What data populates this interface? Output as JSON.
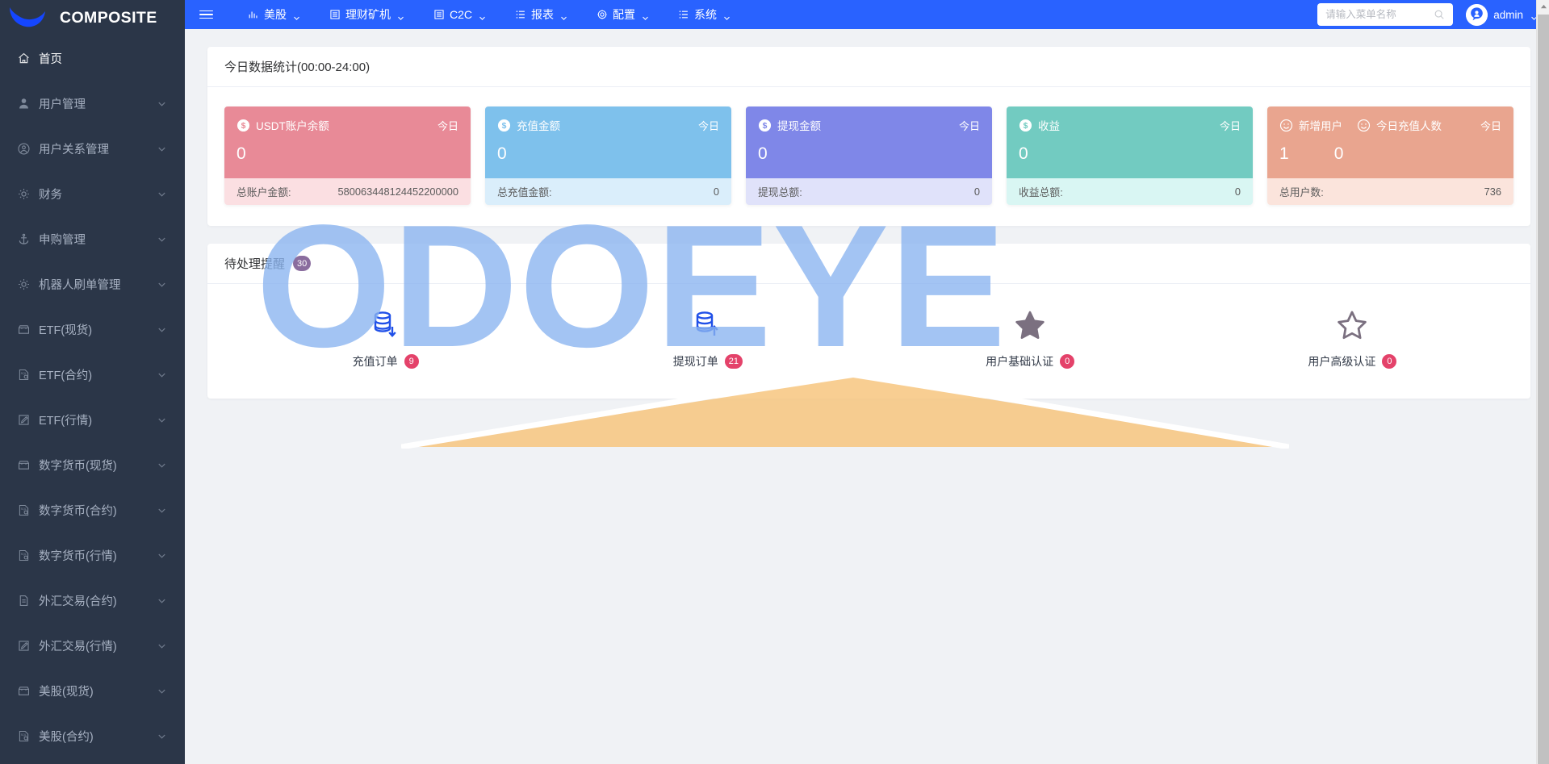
{
  "brand": {
    "title": "COMPOSITE",
    "logo_icon": "crescent-logo-icon"
  },
  "sidebar": {
    "items": [
      {
        "label": "首页",
        "icon": "home-icon",
        "active": true,
        "expandable": false
      },
      {
        "label": "用户管理",
        "icon": "user-icon",
        "active": false,
        "expandable": true
      },
      {
        "label": "用户关系管理",
        "icon": "user-circle-icon",
        "active": false,
        "expandable": true
      },
      {
        "label": "财务",
        "icon": "gear-icon",
        "active": false,
        "expandable": true
      },
      {
        "label": "申购管理",
        "icon": "anchor-icon",
        "active": false,
        "expandable": true
      },
      {
        "label": "机器人刷单管理",
        "icon": "gear-icon",
        "active": false,
        "expandable": true
      },
      {
        "label": "ETF(现货)",
        "icon": "shop-icon",
        "active": false,
        "expandable": true
      },
      {
        "label": "ETF(合约)",
        "icon": "sql-icon",
        "active": false,
        "expandable": true
      },
      {
        "label": "ETF(行情)",
        "icon": "edit-icon",
        "active": false,
        "expandable": true
      },
      {
        "label": "数字货币(现货)",
        "icon": "shop-icon",
        "active": false,
        "expandable": true
      },
      {
        "label": "数字货币(合约)",
        "icon": "sql-icon",
        "active": false,
        "expandable": true
      },
      {
        "label": "数字货币(行情)",
        "icon": "sql-icon",
        "active": false,
        "expandable": true
      },
      {
        "label": "外汇交易(合约)",
        "icon": "document-icon",
        "active": false,
        "expandable": true
      },
      {
        "label": "外汇交易(行情)",
        "icon": "edit-icon",
        "active": false,
        "expandable": true
      },
      {
        "label": "美股(现货)",
        "icon": "shop-icon",
        "active": false,
        "expandable": true
      },
      {
        "label": "美股(合约)",
        "icon": "sql-icon",
        "active": false,
        "expandable": true
      }
    ]
  },
  "navbar": {
    "menu_toggle_icon": "hamburger-icon",
    "items": [
      {
        "label": "美股",
        "icon": "chart-bar-icon"
      },
      {
        "label": "理财矿机",
        "icon": "list-box-icon"
      },
      {
        "label": "C2C",
        "icon": "list-box-icon"
      },
      {
        "label": "报表",
        "icon": "list-icon"
      },
      {
        "label": "配置",
        "icon": "gear-icon"
      },
      {
        "label": "系统",
        "icon": "list-icon"
      }
    ],
    "search": {
      "placeholder": "请输入菜单名称",
      "value": "",
      "icon": "search-icon"
    },
    "user": {
      "name": "admin",
      "avatar_icon": "user-avatar-icon",
      "caret_icon": "chevron-down-icon"
    }
  },
  "stats_panel": {
    "title": "今日数据统计(00:00-24:00)",
    "cards": [
      {
        "id": "usdt-balance",
        "bg": "#e88a97",
        "foot_bg": "#fbdfe2",
        "metrics": [
          {
            "icon": "dollar-circle-icon",
            "title": "USDT账户余额",
            "value": "0"
          }
        ],
        "today_label": "今日",
        "foot_label": "总账户金额:",
        "foot_value": "580063448124452200000"
      },
      {
        "id": "deposit-amount",
        "bg": "#7ec1ec",
        "foot_bg": "#daeefb",
        "metrics": [
          {
            "icon": "dollar-circle-icon",
            "title": "充值金额",
            "value": "0"
          }
        ],
        "today_label": "今日",
        "foot_label": "总充值金额:",
        "foot_value": "0"
      },
      {
        "id": "withdraw-amount",
        "bg": "#7f87e8",
        "foot_bg": "#e0e2fa",
        "metrics": [
          {
            "icon": "dollar-circle-icon",
            "title": "提现金额",
            "value": "0"
          }
        ],
        "today_label": "今日",
        "foot_label": "提现总额:",
        "foot_value": "0"
      },
      {
        "id": "profit",
        "bg": "#72cbc1",
        "foot_bg": "#d9f6f3",
        "metrics": [
          {
            "icon": "dollar-circle-icon",
            "title": "收益",
            "value": "0"
          }
        ],
        "today_label": "今日",
        "foot_label": "收益总额:",
        "foot_value": "0"
      },
      {
        "id": "new-users",
        "bg": "#e9a58f",
        "foot_bg": "#fbe4dc",
        "metrics": [
          {
            "icon": "smiley-icon",
            "title": "新增用户",
            "value": "1"
          },
          {
            "icon": "smiley-icon",
            "title": "今日充值人数",
            "value": "0"
          }
        ],
        "today_label": "今日",
        "foot_label": "总用户数:",
        "foot_value": "736"
      }
    ]
  },
  "pending_panel": {
    "title": "待处理提醒",
    "badge": "30",
    "tasks": [
      {
        "label": "充值订单",
        "count": "9",
        "icon": "database-download-icon"
      },
      {
        "label": "提现订单",
        "count": "21",
        "icon": "database-upload-icon"
      },
      {
        "label": "用户基础认证",
        "count": "0",
        "icon": "star-filled-icon"
      },
      {
        "label": "用户高级认证",
        "count": "0",
        "icon": "star-outline-icon"
      }
    ]
  },
  "watermark": {
    "text": "ODOEYE",
    "color": "#8ab4f0"
  },
  "colors": {
    "nav_blue": "#2962ff",
    "sidebar_dark": "#2b3648",
    "content_bg": "#f0f2f5",
    "badge_red": "#e4426a",
    "badge_purple": "#8a6d9e"
  },
  "scrollbar": {
    "present": true
  }
}
